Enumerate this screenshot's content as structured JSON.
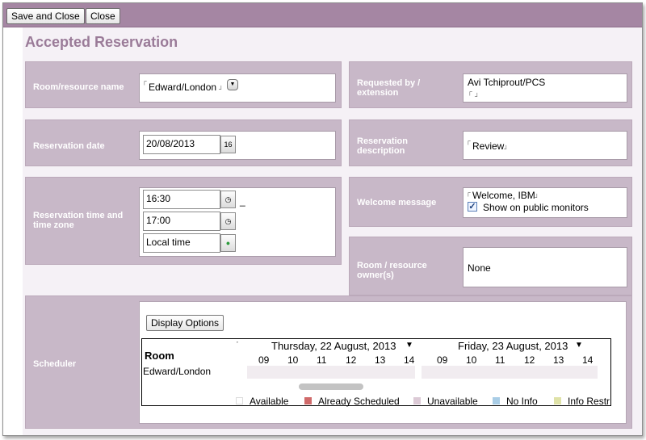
{
  "toolbar": {
    "save_close_label": "Save and Close",
    "close_label": "Close"
  },
  "page": {
    "title": "Accepted Reservation"
  },
  "fields": {
    "room_resource": {
      "label": "Room/resource name",
      "value": "Edward/London"
    },
    "requested_by": {
      "label": "Requested by / extension",
      "value": "Avi Tchiprout/PCS"
    },
    "reservation_date": {
      "label": "Reservation date",
      "value": "20/08/2013",
      "picker": "16"
    },
    "reservation_description": {
      "label": "Reservation description",
      "value": "Review"
    },
    "reservation_time": {
      "label": "Reservation time and time zone",
      "start": "16:30",
      "end": "17:00",
      "separator": "_",
      "timezone": "Local time"
    },
    "welcome_message": {
      "label": "Welcome message",
      "value": "Welcome, IBM",
      "checkbox_label": "Show on public monitors",
      "checked": true
    },
    "owner": {
      "label": "Room / resource owner(s)",
      "value": "None"
    }
  },
  "scheduler": {
    "label": "Scheduler",
    "display_options_label": "Display Options",
    "room_header": "Room",
    "room_name": "Edward/London",
    "day1": "Thursday, 22 August, 2013",
    "day2": "Friday, 23 August, 2013",
    "hours": [
      "09",
      "10",
      "11",
      "12",
      "13",
      "14"
    ],
    "legend": [
      {
        "label": "Available",
        "color": "#ffffff"
      },
      {
        "label": "Already Scheduled",
        "color": "#d06a6a"
      },
      {
        "label": "Unavailable",
        "color": "#dccad6"
      },
      {
        "label": "No Info",
        "color": "#a9cde6"
      },
      {
        "label": "Info Restr",
        "color": "#dfe2a8"
      }
    ]
  }
}
